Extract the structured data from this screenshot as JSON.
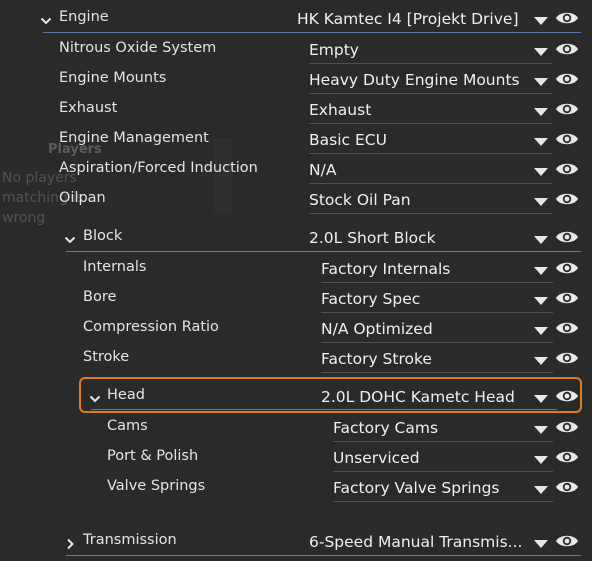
{
  "background_panel": {
    "heading": "Players",
    "message": "No players matching is wrong"
  },
  "engine": {
    "label": "Engine",
    "value": "HK Kamtec I4 [Projekt Drive]",
    "children": [
      {
        "label": "Nitrous Oxide System",
        "value": "Empty"
      },
      {
        "label": "Engine Mounts",
        "value": "Heavy Duty Engine Mounts"
      },
      {
        "label": "Exhaust",
        "value": "Exhaust"
      },
      {
        "label": "Engine Management",
        "value": "Basic ECU"
      },
      {
        "label": "Aspiration/Forced Induction",
        "value": "N/A"
      },
      {
        "label": "Oilpan",
        "value": "Stock Oil Pan"
      }
    ]
  },
  "block": {
    "label": "Block",
    "value": "2.0L Short Block",
    "children": [
      {
        "label": "Internals",
        "value": "Factory Internals"
      },
      {
        "label": "Bore",
        "value": "Factory Spec"
      },
      {
        "label": "Compression Ratio",
        "value": "N/A Optimized"
      },
      {
        "label": "Stroke",
        "value": "Factory Stroke"
      }
    ]
  },
  "head": {
    "label": "Head",
    "value": "2.0L DOHC Kametc Head",
    "children": [
      {
        "label": "Cams",
        "value": "Factory Cams"
      },
      {
        "label": "Port & Polish",
        "value": "Unserviced"
      },
      {
        "label": "Valve Springs",
        "value": "Factory Valve Springs"
      }
    ]
  },
  "transmission": {
    "label": "Transmission",
    "value": "6-Speed Manual Transmis..."
  },
  "icons": {
    "expand": "chevron-down-icon",
    "collapse": "chevron-right-icon",
    "dropdown": "caret-down-icon",
    "visibility": "eye-icon"
  },
  "colors": {
    "background": "#2a2a2a",
    "separator": "#5b7da6",
    "highlight": "#e07b1f"
  }
}
